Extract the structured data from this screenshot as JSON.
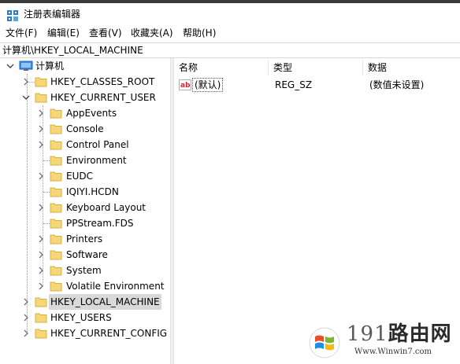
{
  "window": {
    "title": "注册表编辑器"
  },
  "menu": [
    {
      "label": "文件(F)"
    },
    {
      "label": "编辑(E)"
    },
    {
      "label": "查看(V)"
    },
    {
      "label": "收藏夹(A)"
    },
    {
      "label": "帮助(H)"
    }
  ],
  "address": {
    "path": "计算机\\HKEY_LOCAL_MACHINE"
  },
  "tree": {
    "root": "计算机",
    "hives": {
      "classes_root": "HKEY_CLASSES_ROOT",
      "current_user": "HKEY_CURRENT_USER",
      "local_machine": "HKEY_LOCAL_MACHINE",
      "users": "HKEY_USERS",
      "current_config": "HKEY_CURRENT_CONFIG"
    },
    "current_user_children": [
      "AppEvents",
      "Console",
      "Control Panel",
      "Environment",
      "EUDC",
      "IQIYI.HCDN",
      "Keyboard Layout",
      "PPStream.FDS",
      "Printers",
      "Software",
      "System",
      "Volatile Environment"
    ],
    "selected": "HKEY_LOCAL_MACHINE"
  },
  "list": {
    "columns": {
      "name": "名称",
      "type": "类型",
      "data": "数据"
    },
    "rows": [
      {
        "name": "(默认)",
        "type": "REG_SZ",
        "data": "(数值未设置)"
      }
    ]
  },
  "watermark": {
    "brand_digits": "191",
    "brand_text": "路由网",
    "site": "Www.Winwin7.com"
  },
  "colors": {
    "folder": "#f5d679",
    "folder_edge": "#d9b13c",
    "selection": "#d9d9d9",
    "watermark_text": "#2b2b2b"
  }
}
